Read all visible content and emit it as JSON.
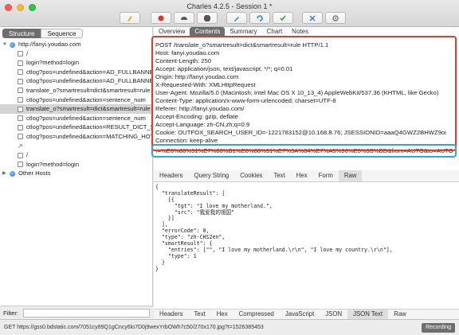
{
  "window": {
    "title": "Charles 4.2.5 - Session 1 *"
  },
  "toolbar": {
    "buttons": [
      "broom-icon",
      "record-icon",
      "throttle-icon",
      "breakpoint-icon",
      "compose-icon",
      "repeat-icon",
      "validate-icon",
      "tools-icon",
      "settings-icon"
    ]
  },
  "left": {
    "tabs": {
      "structure": "Structure",
      "sequence": "Sequence"
    },
    "tree": [
      {
        "indent": 0,
        "icon": "globe",
        "text": "http://fanyi.youdao.com"
      },
      {
        "indent": 1,
        "icon": "doc",
        "text": "/"
      },
      {
        "indent": 1,
        "icon": "doc",
        "text": "login?method=login"
      },
      {
        "indent": 1,
        "icon": "doc",
        "text": "ctlog?pos=undefined&action=AD_FULLBANNER"
      },
      {
        "indent": 1,
        "icon": "doc",
        "text": "ctlog?pos=undefined&action=AD_FULLBANNER"
      },
      {
        "indent": 1,
        "icon": "doc",
        "text": "translate_o?smartresult=dict&smartresult=rule"
      },
      {
        "indent": 1,
        "icon": "doc",
        "text": "ctlog?pos=undefined&action=sentence_num"
      },
      {
        "indent": 1,
        "icon": "doc",
        "text": "translate_o?smartresult=dict&smartresult=rule",
        "selected": true
      },
      {
        "indent": 1,
        "icon": "doc",
        "text": "ctlog?pos=undefined&action=sentence_num"
      },
      {
        "indent": 1,
        "icon": "doc",
        "text": "ctlog?pos=undefined&action=RESULT_DICT_SHOW"
      },
      {
        "indent": 1,
        "icon": "doc",
        "text": "ctlog?pos=undefined&action=MATCHING_HOT"
      },
      {
        "indent": 1,
        "icon": "link",
        "text": ""
      },
      {
        "indent": 1,
        "icon": "doc",
        "text": "/"
      },
      {
        "indent": 1,
        "icon": "doc",
        "text": "login?method=login"
      },
      {
        "indent": 0,
        "icon": "globe",
        "text": "Other Hosts",
        "collapsed": true
      }
    ],
    "filter": {
      "label": "Filter:",
      "value": ""
    }
  },
  "right": {
    "tabs": [
      "Overview",
      "Contents",
      "Summary",
      "Chart",
      "Notes"
    ],
    "active_tab": "Contents",
    "request_headers": [
      "POST /translate_o?smartresult=dict&smartresult=rule HTTP/1.1",
      "Host: fanyi.youdao.com",
      "Content-Length: 250",
      "Accept: application/json, text/javascript, */*; q=0.01",
      "Origin: http://fanyi.youdao.com",
      "X-Requested-With: XMLHttpRequest",
      "User-Agent: Mozilla/5.0 (Macintosh; Intel Mac OS X 10_13_4) AppleWebKit/537.36 (KHTML, like Gecko)",
      "Content-Type: application/x-www-form-urlencoded; charset=UTF-8",
      "Referer: http://fanyi.youdao.com/",
      "Accept-Encoding: gzip, deflate",
      "Accept-Language: zh-CN,zh;q=0.9",
      "Cookie: OUTFOX_SEARCH_USER_ID=-1221783152@10.168.8.76; JSESSIONID=aaaQ4GWZ2BHWZ9oi",
      "Connection: keep-alive"
    ],
    "query_string": "i=%E6%88%91%E7%88%B1%E6%88%91%E7%9A%84%E7%A5%96%E5%9B%BD&from=AUTO&to=AUTO",
    "response_tabs": [
      "Headers",
      "Query String",
      "Cookies",
      "Text",
      "Hex",
      "Form",
      "Raw"
    ],
    "active_response_tab": "Raw",
    "json_lines": [
      "{",
      "  \"translateResult\": [",
      "    [{",
      "      \"tgt\": \"I love my motherland.\",",
      "      \"src\": \"我爱我的祖国\"",
      "    }]",
      "  ],",
      "  \"errorCode\": 0,",
      "  \"type\": \"zh-CHS2en\",",
      "  \"smartResult\": {",
      "    \"entries\": [\"\", \"I love my motherland.\\r\\n\", \"I love my country.\\r\\n\"],",
      "    \"type\": 1",
      "  }",
      "}"
    ],
    "bottom_tabs": [
      "Headers",
      "Text",
      "Hex",
      "Compressed",
      "JavaScript",
      "JSON",
      "JSON Text",
      "Raw"
    ],
    "active_bottom_tab": "JSON Text"
  },
  "status": {
    "message": "GET https://gss0.bdstatic.com/7051cy89Q1gCncy6lo7D0j9wexYrbOWh7c50/270x170.jpg?t=1526385453",
    "recording": "Recording"
  },
  "colors": {
    "highlight_red": "#e53b2a",
    "highlight_blue": "#2fa6dc",
    "tab_active": "#6d6d6d"
  }
}
